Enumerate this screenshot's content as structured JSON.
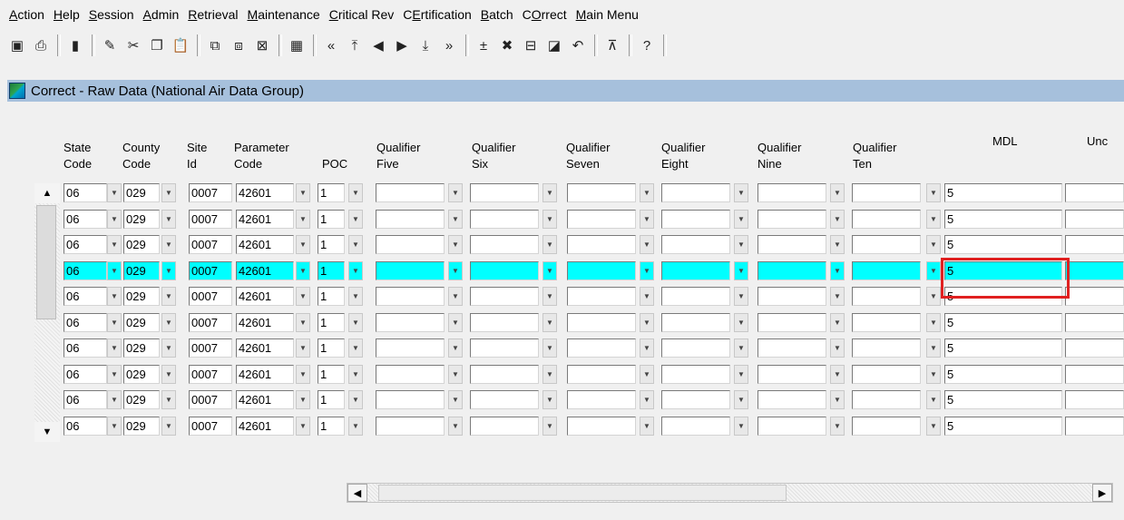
{
  "menu": [
    {
      "pre": "",
      "ul": "A",
      "post": "ction"
    },
    {
      "pre": "",
      "ul": "H",
      "post": "elp"
    },
    {
      "pre": "",
      "ul": "S",
      "post": "ession"
    },
    {
      "pre": "",
      "ul": "A",
      "post": "dmin"
    },
    {
      "pre": "",
      "ul": "R",
      "post": "etrieval"
    },
    {
      "pre": "",
      "ul": "M",
      "post": "aintenance"
    },
    {
      "pre": "",
      "ul": "C",
      "post": "ritical Rev"
    },
    {
      "pre": "C",
      "ul": "E",
      "post": "rtification"
    },
    {
      "pre": "",
      "ul": "B",
      "post": "atch"
    },
    {
      "pre": "C",
      "ul": "O",
      "post": "rrect"
    },
    {
      "pre": "",
      "ul": "M",
      "post": "ain Menu"
    }
  ],
  "window": {
    "title": "Correct - Raw Data (National Air Data Group)"
  },
  "headers": {
    "state": "State\nCode",
    "county": "County\nCode",
    "site": "Site\nId",
    "parameter": "Parameter\nCode",
    "poc": "POC",
    "q5": "Qualifier\nFive",
    "q6": "Qualifier\nSix",
    "q7": "Qualifier\nSeven",
    "q8": "Qualifier\nEight",
    "q9": "Qualifier\nNine",
    "q10": "Qualifier\nTen",
    "mdl": "MDL",
    "unc": "Unc"
  },
  "rows": [
    {
      "state": "06",
      "county": "029",
      "site": "0007",
      "param": "42601",
      "poc": "1",
      "mdl": "5"
    },
    {
      "state": "06",
      "county": "029",
      "site": "0007",
      "param": "42601",
      "poc": "1",
      "mdl": "5"
    },
    {
      "state": "06",
      "county": "029",
      "site": "0007",
      "param": "42601",
      "poc": "1",
      "mdl": "5"
    },
    {
      "state": "06",
      "county": "029",
      "site": "0007",
      "param": "42601",
      "poc": "1",
      "mdl": "5"
    },
    {
      "state": "06",
      "county": "029",
      "site": "0007",
      "param": "42601",
      "poc": "1",
      "mdl": "5"
    },
    {
      "state": "06",
      "county": "029",
      "site": "0007",
      "param": "42601",
      "poc": "1",
      "mdl": "5"
    },
    {
      "state": "06",
      "county": "029",
      "site": "0007",
      "param": "42601",
      "poc": "1",
      "mdl": "5"
    },
    {
      "state": "06",
      "county": "029",
      "site": "0007",
      "param": "42601",
      "poc": "1",
      "mdl": "5"
    },
    {
      "state": "06",
      "county": "029",
      "site": "0007",
      "param": "42601",
      "poc": "1",
      "mdl": "5"
    },
    {
      "state": "06",
      "county": "029",
      "site": "0007",
      "param": "42601",
      "poc": "1",
      "mdl": "5"
    }
  ],
  "selected_row": 3,
  "colors": {
    "selection": "#00ffff",
    "highlight_box": "#e02020",
    "titlebar": "#a6c0dc"
  }
}
